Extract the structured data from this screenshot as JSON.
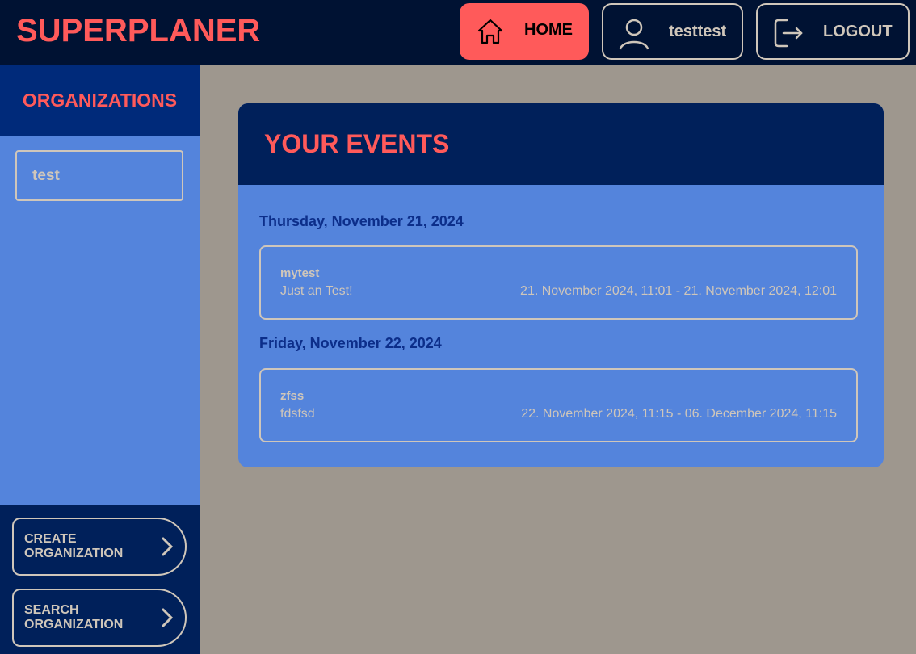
{
  "header": {
    "brand": "SUPERPLANER",
    "home_label": "HOME",
    "user_label": "testtest",
    "logout_label": "LOGOUT"
  },
  "sidebar": {
    "title": "ORGANIZATIONS",
    "organizations": [
      {
        "name": "test"
      }
    ],
    "create_label": "CREATE ORGANIZATION",
    "search_label": "SEARCH ORGANIZATION"
  },
  "main": {
    "title": "YOUR EVENTS",
    "days": [
      {
        "date": "Thursday, November 21, 2024",
        "events": [
          {
            "title": "mytest",
            "description": "Just an Test!",
            "range": "21. November 2024, 11:01 - 21. November 2024, 12:01"
          }
        ]
      },
      {
        "date": "Friday, November 22, 2024",
        "events": [
          {
            "title": "zfss",
            "description": "fdsfsd",
            "range": "22. November 2024, 11:15 - 06. December 2024, 11:15"
          }
        ]
      }
    ]
  },
  "colors": {
    "accent": "#ff5a5a",
    "navy": "#001233",
    "blue": "#5484dc"
  }
}
